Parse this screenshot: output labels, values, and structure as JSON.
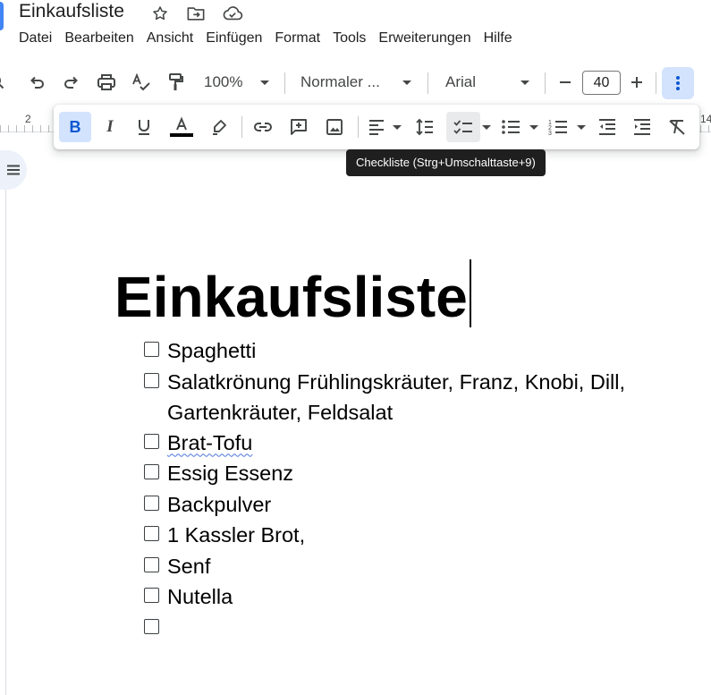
{
  "document": {
    "title": "Einkaufsliste"
  },
  "menu": [
    "Datei",
    "Bearbeiten",
    "Ansicht",
    "Einfügen",
    "Format",
    "Tools",
    "Erweiterungen",
    "Hilfe"
  ],
  "toolbar": {
    "zoom": "100%",
    "style": "Normaler ...",
    "font": "Arial",
    "font_size": "40"
  },
  "ruler": {
    "left_number": "2",
    "right_number": "14"
  },
  "tooltip": {
    "text": "Checkliste (Strg+Umschalttaste+9)"
  },
  "content": {
    "heading": "Einkaufsliste",
    "items": [
      {
        "text": "Spaghetti",
        "checked": false
      },
      {
        "text": "Salatkrönung Frühlingskräuter, Franz, Knobi, Dill, Gartenkräuter, Feldsalat",
        "checked": false
      },
      {
        "text": "Brat-Tofu",
        "checked": false,
        "spellcheck": true
      },
      {
        "text": "Essig Essenz",
        "checked": false
      },
      {
        "text": "Backpulver",
        "checked": false
      },
      {
        "text": "1 Kassler Brot,",
        "checked": false
      },
      {
        "text": "Senf",
        "checked": false
      },
      {
        "text": "Nutella",
        "checked": false
      },
      {
        "text": "",
        "checked": false
      }
    ]
  },
  "colors": {
    "accent": "#d3e3fd",
    "doc_icon": "#4285f4",
    "tooltip_bg": "#1f1f1f",
    "spellcheck": "#4b74e1"
  },
  "icons": {
    "title": [
      "star-icon",
      "move-to-folder-icon",
      "cloud-saved-icon"
    ],
    "toolbar": [
      "search-icon",
      "undo-icon",
      "redo-icon",
      "print-icon",
      "spellcheck-icon",
      "paint-format-icon"
    ],
    "format": [
      "bold-icon",
      "italic-icon",
      "underline-icon",
      "text-color-icon",
      "highlight-icon",
      "link-icon",
      "add-comment-icon",
      "insert-image-icon",
      "align-left-icon",
      "line-spacing-icon",
      "checklist-icon",
      "bulleted-list-icon",
      "numbered-list-icon",
      "decrease-indent-icon",
      "increase-indent-icon",
      "clear-formatting-icon"
    ]
  }
}
